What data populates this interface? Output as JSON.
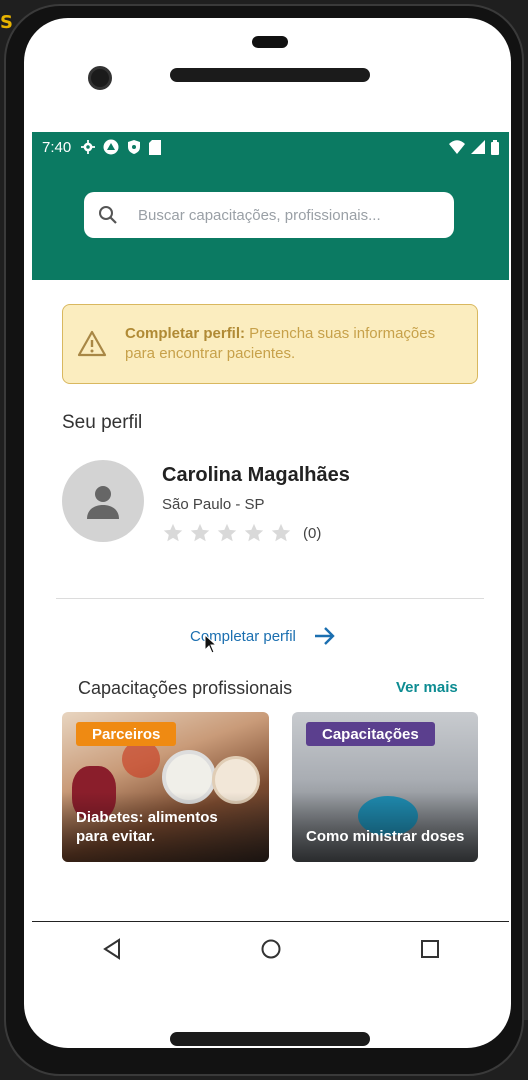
{
  "desktop": {
    "corner_glyph": "S"
  },
  "statusbar": {
    "time": "7:40",
    "icons_left": [
      "gear-icon",
      "android-icon",
      "shield-icon",
      "sim-card-icon"
    ],
    "icons_right": [
      "wifi-icon",
      "signal-icon",
      "battery-icon"
    ]
  },
  "search": {
    "placeholder": "Buscar capacitações, profissionais..."
  },
  "warning": {
    "bold": "Completar perfil:",
    "text": " Preencha suas informações para encontrar pacientes."
  },
  "profile": {
    "section_title": "Seu perfil",
    "name": "Carolina Magalhães",
    "location": "São Paulo - SP",
    "rating_stars": 0,
    "rating_max": 5,
    "rating_count": "(0)"
  },
  "complete_profile": {
    "label": "Completar perfil"
  },
  "trainings": {
    "title": "Capacitações profissionais",
    "see_more": "Ver mais",
    "cards": [
      {
        "tag": "Parceiros",
        "title": "Diabetes: alimentos para evitar."
      },
      {
        "tag": "Capacitações",
        "title": "Como ministrar doses"
      }
    ]
  },
  "colors": {
    "brand": "#0b7a62",
    "warning_bg": "#fbedbf",
    "link": "#1b6fb0",
    "tag_partner": "#ef8a12",
    "tag_training": "#5b3f8e"
  },
  "navbar": {
    "buttons": [
      "back-icon",
      "home-icon",
      "recents-icon"
    ]
  }
}
